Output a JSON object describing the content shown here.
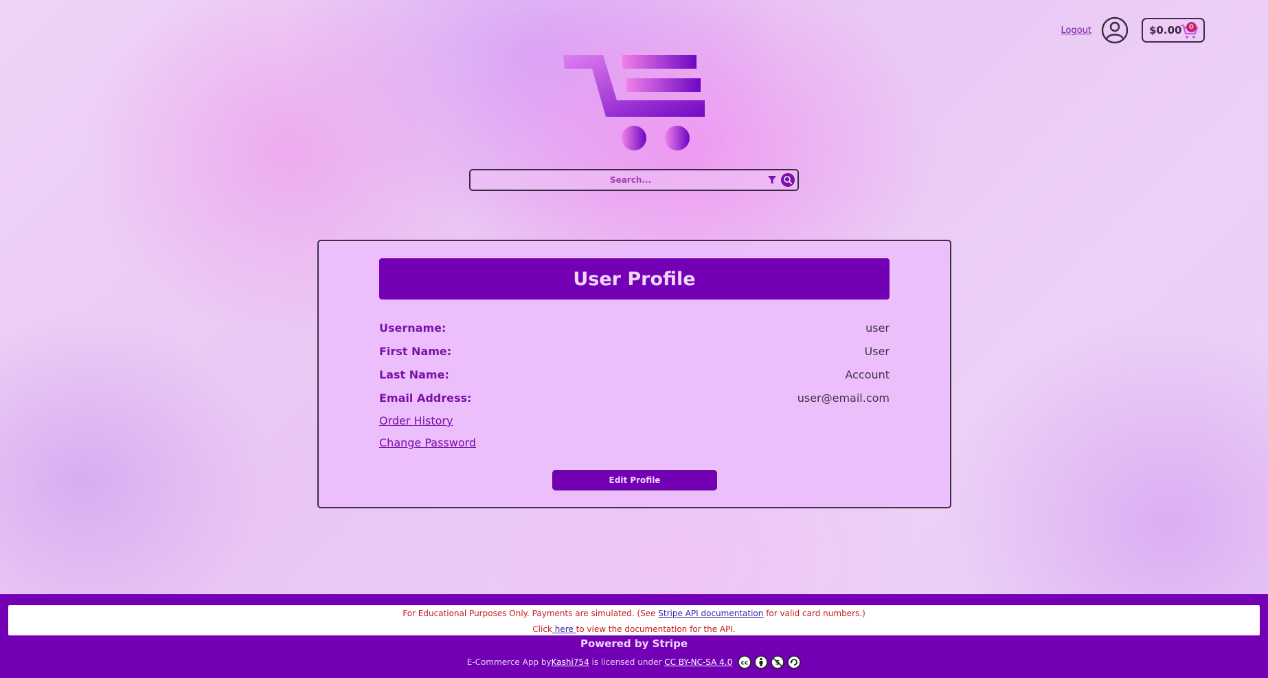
{
  "header": {
    "logout_label": "Logout",
    "cart_total": "$0.00",
    "cart_count": "0",
    "icons": {
      "account": "user-circle-icon",
      "cart": "shopping-cart-icon",
      "logo": "shopping-cart-logo"
    }
  },
  "search": {
    "placeholder": "Search...",
    "value": "",
    "icons": {
      "filter": "filter-icon",
      "search": "search-icon"
    }
  },
  "profile": {
    "title": "User Profile",
    "fields": [
      {
        "label": "Username:",
        "value": "user"
      },
      {
        "label": "First Name:",
        "value": "User"
      },
      {
        "label": "Last Name:",
        "value": "Account"
      },
      {
        "label": "Email Address:",
        "value": "user@email.com"
      }
    ],
    "links": {
      "order_history": "Order History",
      "change_password": "Change Password"
    },
    "edit_button": "Edit Profile"
  },
  "footer": {
    "notice": {
      "line1_prefix": "For Educational Purposes Only. Payments are simulated. (See ",
      "line1_link": "Stripe API documentation",
      "line1_suffix": " for valid card numbers.)",
      "line2_prefix": "Click",
      "line2_link": " here ",
      "line2_suffix": "to view the documentation for the API."
    },
    "powered_by": "Powered by Stripe",
    "license": {
      "prefix": "E-Commerce App by",
      "author_link": " Kashi754",
      "middle": " is licensed under ",
      "license_link": "CC BY-NC-SA 4.0 ",
      "icons": [
        "cc-icon",
        "by-icon",
        "nc-icon",
        "sa-icon"
      ]
    }
  },
  "colors": {
    "primary": "#7300b4",
    "accent_text": "#7a12a8",
    "notice_red": "#c9181c",
    "badge": "#c21f8d"
  }
}
